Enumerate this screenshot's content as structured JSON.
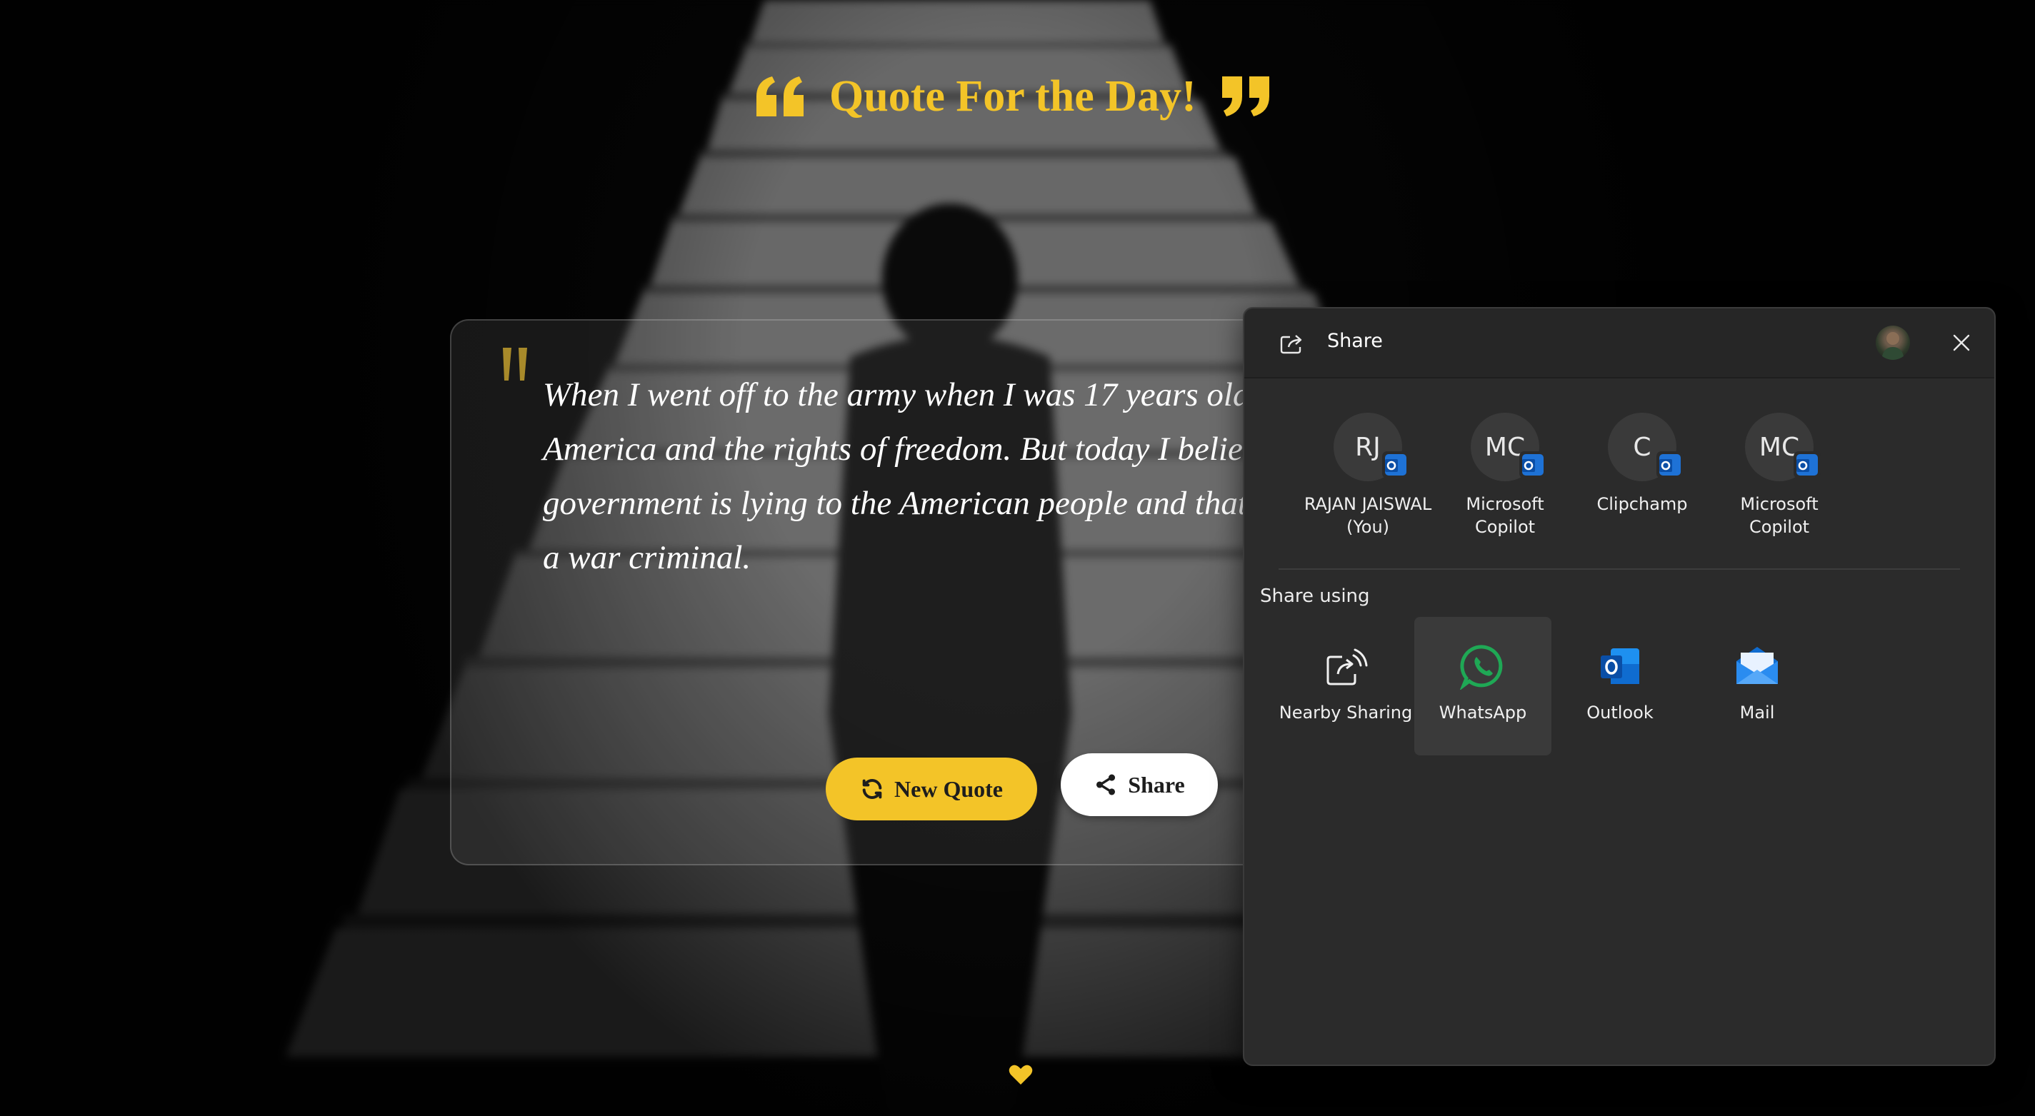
{
  "page": {
    "title": "Quote For the Day!",
    "accent_color": "#f3c428"
  },
  "quote": {
    "text": "When I went off to the army when I was 17 years old, I believed in America and the rights of freedom. But today I believe my government is lying to the American people and that my president is a war criminal.",
    "new_quote_label": "New Quote",
    "share_label": "Share"
  },
  "share_dialog": {
    "title": "Share",
    "contacts": [
      {
        "initials": "RJ",
        "name": "RAJAN JAISWAL (You)"
      },
      {
        "initials": "MC",
        "name": "Microsoft Copilot"
      },
      {
        "initials": "C",
        "name": "Clipchamp"
      },
      {
        "initials": "MC",
        "name": "Microsoft Copilot"
      }
    ],
    "share_using_label": "Share using",
    "apps": [
      {
        "label": "Nearby Sharing",
        "icon": "nearby-sharing-icon"
      },
      {
        "label": "WhatsApp",
        "icon": "whatsapp-icon"
      },
      {
        "label": "Outlook",
        "icon": "outlook-icon"
      },
      {
        "label": "Mail",
        "icon": "mail-icon"
      }
    ]
  }
}
